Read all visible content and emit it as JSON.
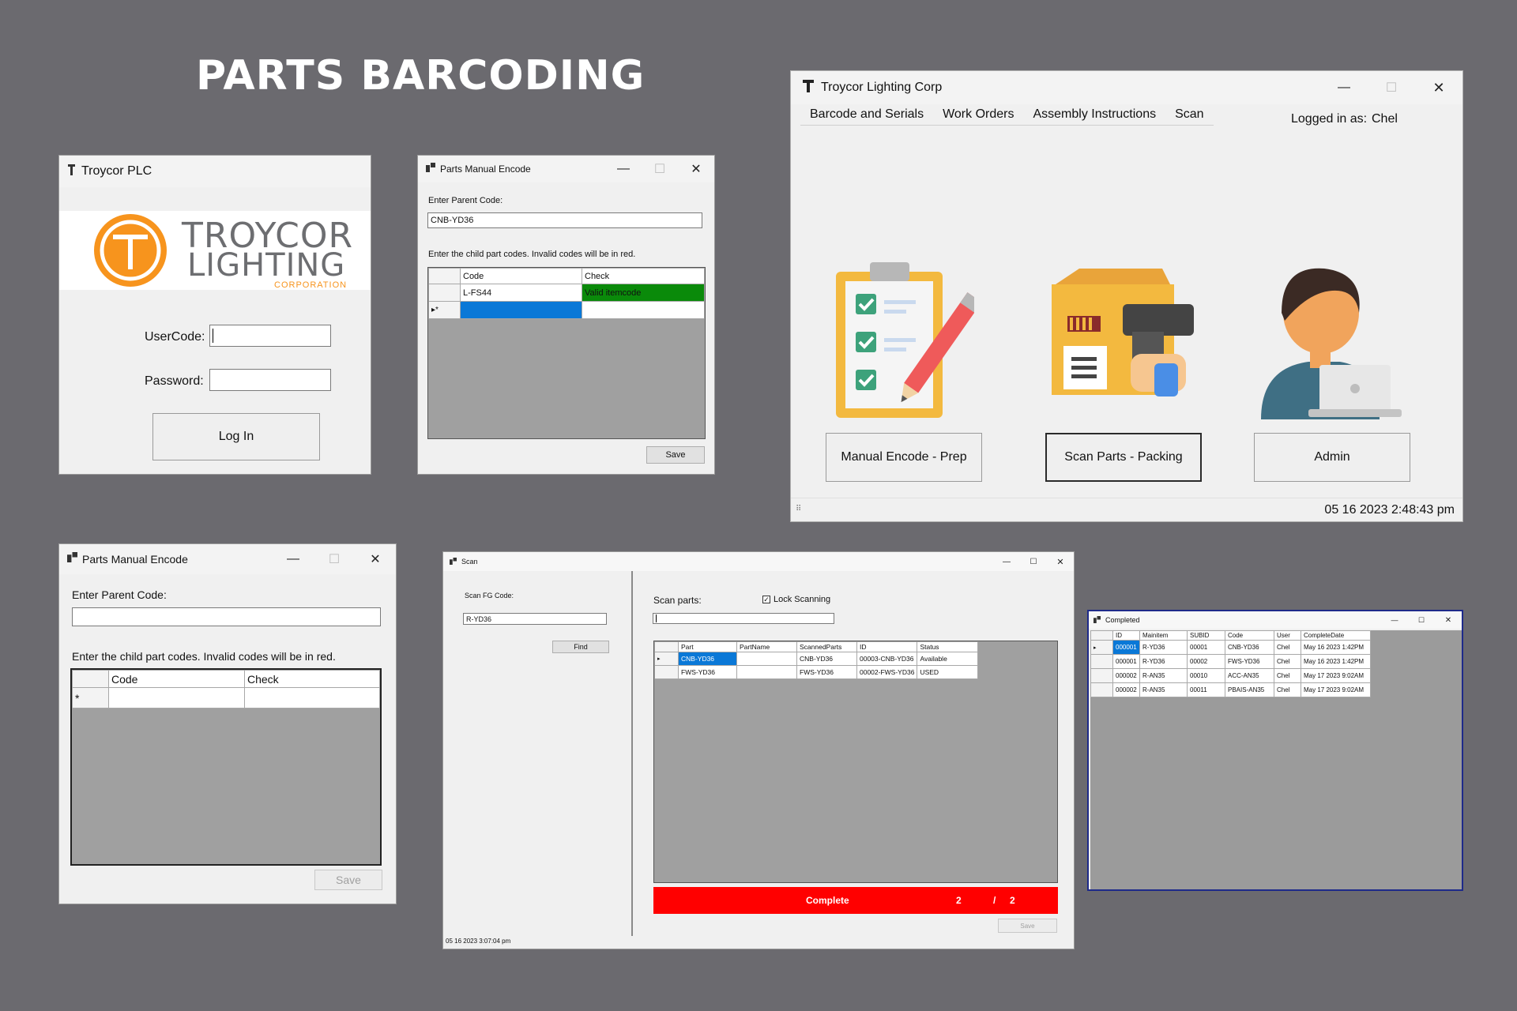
{
  "title": "PARTS BARCODING",
  "login": {
    "window_title": "Troycor PLC",
    "logo_line1": "TROYCOR",
    "logo_line2": "LIGHTING",
    "logo_line3": "CORPORATION",
    "usercode_label": "UserCode:",
    "password_label": "Password:",
    "login_button": "Log In"
  },
  "encode1": {
    "window_title": "Parts Manual Encode",
    "parent_label": "Enter Parent Code:",
    "parent_value": "CNB-YD36",
    "child_label": "Enter the child part codes. Invalid codes will be in red.",
    "columns": [
      "Code",
      "Check"
    ],
    "rows": [
      {
        "code": "L-FS44",
        "check": "Valid itemcode"
      }
    ],
    "new_row_marker": "▸*",
    "save_button": "Save",
    "valid_color": "#0a8a0a",
    "selected_color": "#0a78d7"
  },
  "main": {
    "window_title": "Troycor Lighting Corp",
    "menu": [
      "Barcode and Serials",
      "Work Orders",
      "Assembly Instructions",
      "Scan"
    ],
    "logged_in_label": "Logged in as:",
    "logged_in_user": "Chel",
    "buttons": [
      "Manual Encode - Prep",
      "Scan Parts - Packing",
      "Admin"
    ],
    "status_time": "05 16 2023 2:48:43 pm",
    "icons": [
      "clipboard-checklist-icon",
      "barcode-scanner-box-icon",
      "user-laptop-icon"
    ]
  },
  "encode2": {
    "window_title": "Parts Manual Encode",
    "parent_label": "Enter Parent Code:",
    "parent_value": "",
    "child_label": "Enter the child part codes. Invalid codes will be in red.",
    "columns": [
      "Code",
      "Check"
    ],
    "new_row_marker": "*",
    "save_button": "Save"
  },
  "scan": {
    "window_title": "Scan",
    "fg_label": "Scan FG Code:",
    "fg_value": "R-YD36",
    "find_button": "Find",
    "parts_label": "Scan parts:",
    "lock_label": "Lock Scanning",
    "lock_checked": true,
    "columns": [
      "Part",
      "PartName",
      "ScannedParts",
      "ID",
      "Status"
    ],
    "rows": [
      {
        "part": "CNB-YD36",
        "partname": "",
        "scanned": "CNB-YD36",
        "id": "00003-CNB-YD36",
        "status": "Available"
      },
      {
        "part": "FWS-YD36",
        "partname": "",
        "scanned": "FWS-YD36",
        "id": "00002-FWS-YD36",
        "status": "USED"
      }
    ],
    "progress_label": "Complete",
    "progress_done": "2",
    "progress_sep": "/",
    "progress_total": "2",
    "progress_color": "#ff0000",
    "save_button": "Save",
    "status_time": "05 16 2023 3:07:04 pm"
  },
  "completed": {
    "window_title": "Completed",
    "columns": [
      "ID",
      "Mainitem",
      "SUBID",
      "Code",
      "User",
      "CompleteDate"
    ],
    "rows": [
      [
        "000001",
        "R-YD36",
        "00001",
        "CNB-YD36",
        "Chel",
        "May 16 2023  1:42PM"
      ],
      [
        "000001",
        "R-YD36",
        "00002",
        "FWS-YD36",
        "Chel",
        "May 16 2023  1:42PM"
      ],
      [
        "000002",
        "R-AN35",
        "00010",
        "ACC-AN35",
        "Chel",
        "May 17 2023  9:02AM"
      ],
      [
        "000002",
        "R-AN35",
        "00011",
        "PBAIS-AN35",
        "Chel",
        "May 17 2023  9:02AM"
      ]
    ]
  }
}
